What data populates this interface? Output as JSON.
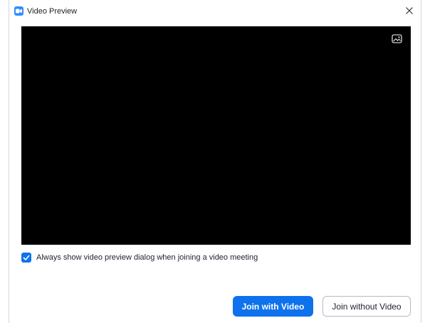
{
  "window": {
    "title": "Video Preview",
    "app_icon": "zoom-camera-icon",
    "close_icon": "close-icon"
  },
  "video_preview": {
    "background_icon": "virtual-background-icon",
    "background_color": "#000000"
  },
  "options": {
    "always_show_preview_label": "Always show video preview dialog when joining a video meeting",
    "always_show_preview_checked": true
  },
  "actions": {
    "join_with_video_label": "Join with Video",
    "join_without_video_label": "Join without Video"
  },
  "colors": {
    "accent": "#0e72ed",
    "app_icon": "#2d8cff"
  }
}
